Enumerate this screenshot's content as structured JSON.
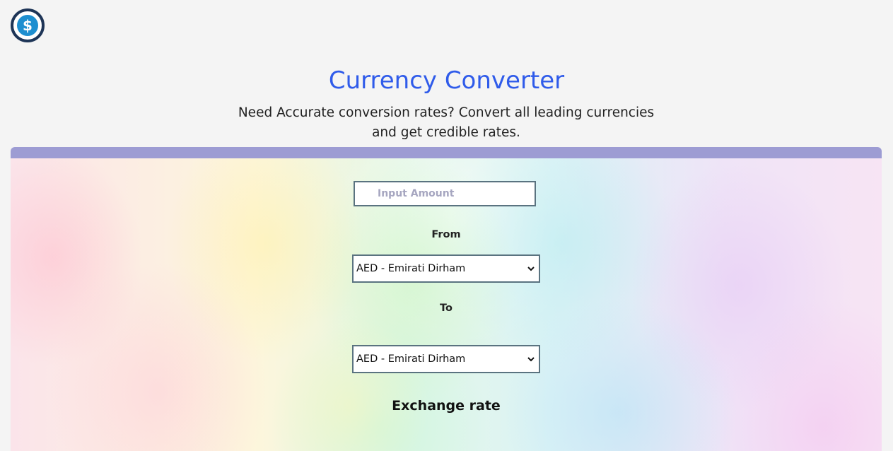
{
  "app": {
    "logo_icon": "dollar-circle-icon",
    "title": "Currency Converter",
    "subtitle": "Need Accurate conversion rates? Convert all leading currencies and get credible rates."
  },
  "colors": {
    "title": "#2f5bea",
    "card_top_bar": "#9d9cd3",
    "logo_ring": "#1e3557",
    "logo_fill": "#1e8fd0"
  },
  "form": {
    "amount": {
      "placeholder": "Input Amount",
      "value": ""
    },
    "from_label": "From",
    "from_selected": "AED - Emirati Dirham",
    "to_label": "To",
    "to_selected": "AED - Emirati Dirham",
    "select_icon": "chevron-down-icon",
    "exchange_rate_label": "Exchange rate"
  }
}
